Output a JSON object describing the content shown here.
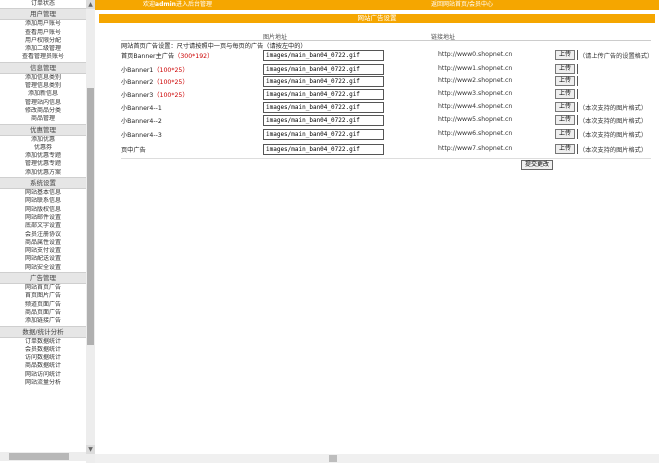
{
  "sidebar": {
    "top_item": "订单状态",
    "groups": [
      {
        "title": "用户管理",
        "items": [
          "添加用户账号",
          "查看用户账号",
          "用户权限分配",
          "添加二级管理",
          "查看管理员账号"
        ]
      },
      {
        "title": "信息管理",
        "items": [
          "添加信息类别",
          "管理信息类别",
          "添加新信息",
          "管理站内信息",
          "修改商品分类",
          "商品管理"
        ]
      },
      {
        "title": "优惠管理",
        "items": [
          "添加优惠",
          "优惠券",
          "添加优惠专题",
          "管理优惠专题",
          "添加优惠方案"
        ]
      },
      {
        "title": "系统设置",
        "items": [
          "网站基本信息",
          "网站联系信息",
          "网站版权信息",
          "网站邮件设置",
          "底部文字设置",
          "会员注册协议",
          "商品属性设置",
          "网站支付设置",
          "网站配送设置",
          "网站安全设置"
        ]
      },
      {
        "title": "广告管理",
        "items": [
          "网站首页广告",
          "首页图片广告",
          "频道页面广告",
          "商品页面广告",
          "添加链接广告"
        ]
      },
      {
        "title": "数据/统计分析",
        "items": [
          "订单数据统计",
          "会员数据统计",
          "访问数据统计",
          "商品数据统计",
          "网站访问统计",
          "网站流量分析"
        ]
      }
    ]
  },
  "topbar": {
    "welcome_prefix": "欢迎",
    "username": "admin",
    "welcome_suffix": "进入后台管理",
    "center_link": "返回网站首页/会员中心"
  },
  "page": {
    "title": "网站广告设置",
    "col_path": "图片地址",
    "col_link": "链接地址",
    "intro": "网站首页广告设置：尺寸请按照中一页与每页的广告（请按左中的）",
    "save_label": "提交更改"
  },
  "rows": [
    {
      "label": "首页Banner主广告",
      "size": "（300*192）",
      "path": "images/main_ban04_0722.gif",
      "url": "http://www0.shopnet.cn",
      "upload": "上传",
      "note": "（请上传广告的设置格式）"
    },
    {
      "label": "小Banner1",
      "size": "（100*25）",
      "path": "images/main_ban04_0722.gif",
      "url": "http://www1.shopnet.cn",
      "upload": "上传",
      "note": ""
    },
    {
      "label": "小Banner2",
      "size": "（100*25）",
      "path": "images/main_ban04_0722.gif",
      "url": "http://www2.shopnet.cn",
      "upload": "上传",
      "note": ""
    },
    {
      "label": "小Banner3",
      "size": "（100*25）",
      "path": "images/main_ban04_0722.gif",
      "url": "http://www3.shopnet.cn",
      "upload": "上传",
      "note": ""
    },
    {
      "label": "小Banner4--1",
      "size": "",
      "path": "images/main_ban04_0722.gif",
      "url": "http://www4.shopnet.cn",
      "upload": "上传",
      "note": "（本次支持的图片格式）"
    },
    {
      "label": "小Banner4--2",
      "size": "",
      "path": "images/main_ban04_0722.gif",
      "url": "http://www5.shopnet.cn",
      "upload": "上传",
      "note": "（本次支持的图片格式）"
    },
    {
      "label": "小Banner4--3",
      "size": "",
      "path": "images/main_ban04_0722.gif",
      "url": "http://www6.shopnet.cn",
      "upload": "上传",
      "note": "（本次支持的图片格式）"
    },
    {
      "label": "页中广告",
      "size": "",
      "path": "images/main_ban04_0722.gif",
      "url": "http://www7.shopnet.cn",
      "upload": "上传",
      "note": "（本次支持的图片格式）"
    }
  ],
  "colors": {
    "accent": "#f5a600",
    "size_red": "#cc0000"
  }
}
